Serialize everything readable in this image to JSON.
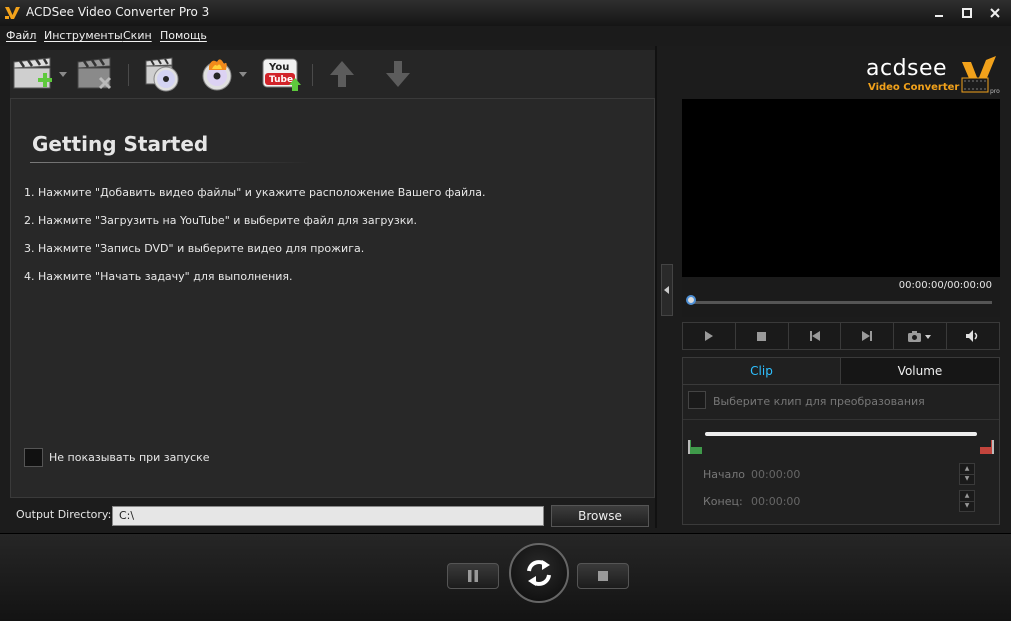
{
  "window": {
    "title": "ACDSee Video Converter Pro 3"
  },
  "menu": [
    {
      "label": "Файл"
    },
    {
      "label": "Инструменты"
    },
    {
      "label": "Скин"
    },
    {
      "label": "Помощь"
    }
  ],
  "toolbar": {
    "youtube_text_top": "You",
    "youtube_text_bottom": "Tube"
  },
  "getting_started": {
    "title": "Getting Started",
    "steps": [
      "1.  Нажмите \"Добавить видео файлы\" и укажите расположение Вашего файла.",
      "2.  Нажмите \"Загрузить на YouTube\" и выберите файл для загрузки.",
      "3.  Нажмите \"Запись DVD\" и выберите видео для прожига.",
      "4.  Нажмите \"Начать задачу\" для выполнения."
    ],
    "dont_show_label": "Не показывать при запуске"
  },
  "output": {
    "label": "Output Directory:",
    "value": "C:\\",
    "browse_label": "Browse"
  },
  "brand": {
    "name": "acdsee",
    "product": "Video Converter",
    "badge": "pro"
  },
  "player": {
    "time": "00:00:00/00:00:00",
    "seek_fraction": 0
  },
  "tabs": {
    "clip_label": "Clip",
    "volume_label": "Volume"
  },
  "clip_panel": {
    "select_label": "Выберите клип для преобразования",
    "start_label": "Начало",
    "start_value": "00:00:00",
    "end_label": "Конец:",
    "end_value": "00:00:00"
  },
  "colors": {
    "accent": "#2ec0ff",
    "add_green": "#5ec93d",
    "remove_red": "#d9534f"
  }
}
